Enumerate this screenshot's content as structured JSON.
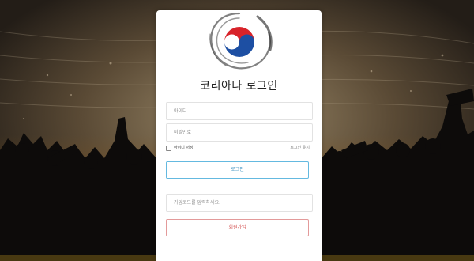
{
  "colors": {
    "login_border": "#64b9e0",
    "join_border": "#e39a9a",
    "join_text": "#d24c4c",
    "logo_red": "#d8232a",
    "logo_blue": "#1d4fa3"
  },
  "login_form": {
    "title": "코리아나 로그인",
    "id_placeholder": "아이디",
    "password_placeholder": "비밀번호",
    "save_id_label": "아이디 저장",
    "keep_label": "로그인 유지",
    "login_button": "로그인",
    "join_code_placeholder": "가입코드를 입력하세요.",
    "join_button": "회원가입"
  }
}
